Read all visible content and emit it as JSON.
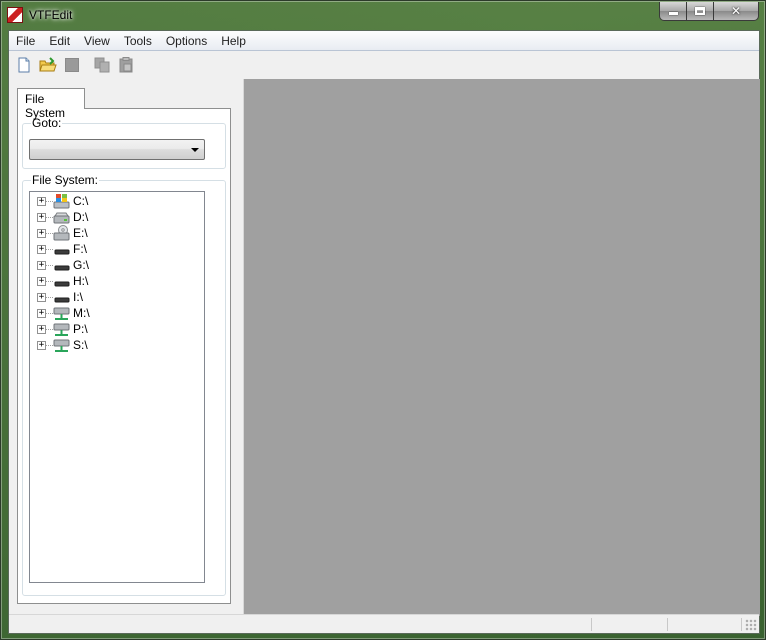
{
  "window": {
    "title": "VTFEdit"
  },
  "menu": [
    "File",
    "Edit",
    "View",
    "Tools",
    "Options",
    "Help"
  ],
  "toolbar": {
    "buttons": [
      {
        "icon": "new-document-icon",
        "enabled": true
      },
      {
        "icon": "open-folder-icon",
        "enabled": true
      },
      {
        "icon": "save-icon",
        "enabled": false
      },
      {
        "icon": "copy-icon",
        "enabled": false
      },
      {
        "icon": "paste-icon",
        "enabled": false
      }
    ]
  },
  "sidebar": {
    "tab_label": "File System",
    "goto_label": "Goto:",
    "goto_value": "",
    "filesystem_label": "File System:",
    "drives": [
      {
        "label": "C:\\",
        "icon": "windows-drive-icon"
      },
      {
        "label": "D:\\",
        "icon": "hard-drive-icon"
      },
      {
        "label": "E:\\",
        "icon": "optical-drive-icon"
      },
      {
        "label": "F:\\",
        "icon": "removable-drive-icon"
      },
      {
        "label": "G:\\",
        "icon": "removable-drive-icon"
      },
      {
        "label": "H:\\",
        "icon": "removable-drive-icon"
      },
      {
        "label": "I:\\",
        "icon": "removable-drive-icon"
      },
      {
        "label": "M:\\",
        "icon": "network-drive-icon"
      },
      {
        "label": "P:\\",
        "icon": "network-drive-icon"
      },
      {
        "label": "S:\\",
        "icon": "network-drive-icon"
      }
    ]
  },
  "colors": {
    "preview_background": "#a0a0a0",
    "client_background": "#f0f0f0"
  }
}
